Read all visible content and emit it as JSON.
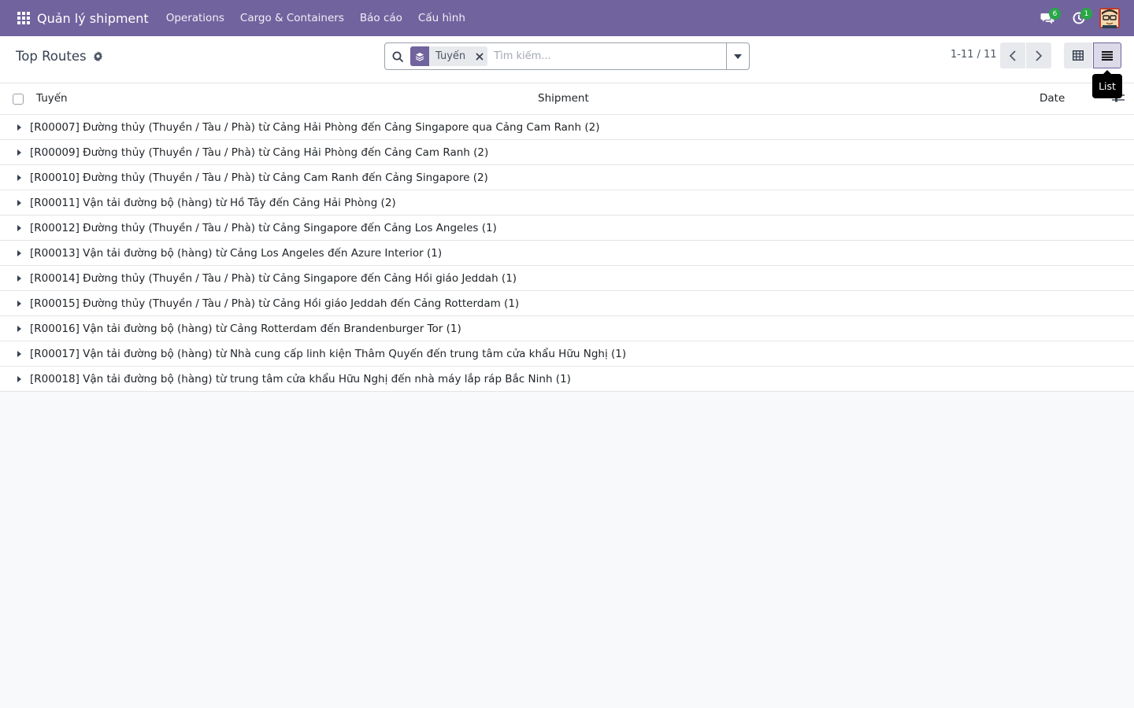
{
  "navbar": {
    "app_name": "Quản lý shipment",
    "menu": [
      "Operations",
      "Cargo & Containers",
      "Báo cáo",
      "Cấu hình"
    ],
    "messages_count": "6",
    "activities_count": "1"
  },
  "control_panel": {
    "title": "Top Routes",
    "search": {
      "facet_label": "Tuyến",
      "placeholder": "Tìm kiếm..."
    },
    "pager": "1-11 / 11",
    "view_tooltip": "List"
  },
  "list": {
    "columns": {
      "route": "Tuyến",
      "shipment": "Shipment",
      "date": "Date"
    },
    "groups": [
      "[R00007] Đường thủy (Thuyền / Tàu / Phà) từ Cảng Hải Phòng đến Cảng Singapore qua Cảng Cam Ranh (2)",
      "[R00009] Đường thủy (Thuyền / Tàu / Phà) từ Cảng Hải Phòng đến Cảng Cam Ranh (2)",
      "[R00010] Đường thủy (Thuyền / Tàu / Phà) từ Cảng Cam Ranh đến Cảng Singapore (2)",
      "[R00011] Vận tải đường bộ (hàng) từ Hồ Tây đến Cảng Hải Phòng (2)",
      "[R00012] Đường thủy (Thuyền / Tàu / Phà) từ Cảng Singapore đến Cảng Los Angeles (1)",
      "[R00013] Vận tải đường bộ (hàng) từ Cảng Los Angeles đến Azure Interior (1)",
      "[R00014] Đường thủy (Thuyền / Tàu / Phà) từ Cảng Singapore đến Cảng Hồi giáo Jeddah (1)",
      "[R00015] Đường thủy (Thuyền / Tàu / Phà) từ Cảng Hồi giáo Jeddah đến Cảng Rotterdam (1)",
      "[R00016] Vận tải đường bộ (hàng) từ Cảng Rotterdam đến Brandenburger Tor (1)",
      "[R00017] Vận tải đường bộ (hàng) từ Nhà cung cấp linh kiện Thâm Quyến đến trung tâm cửa khẩu Hữu Nghị (1)",
      "[R00018] Vận tải đường bộ (hàng) từ trung tâm cửa khẩu Hữu Nghị đến nhà máy lắp ráp Bắc Ninh (1)"
    ]
  },
  "colors": {
    "brand": "#71639e",
    "badge": "#28a745"
  }
}
